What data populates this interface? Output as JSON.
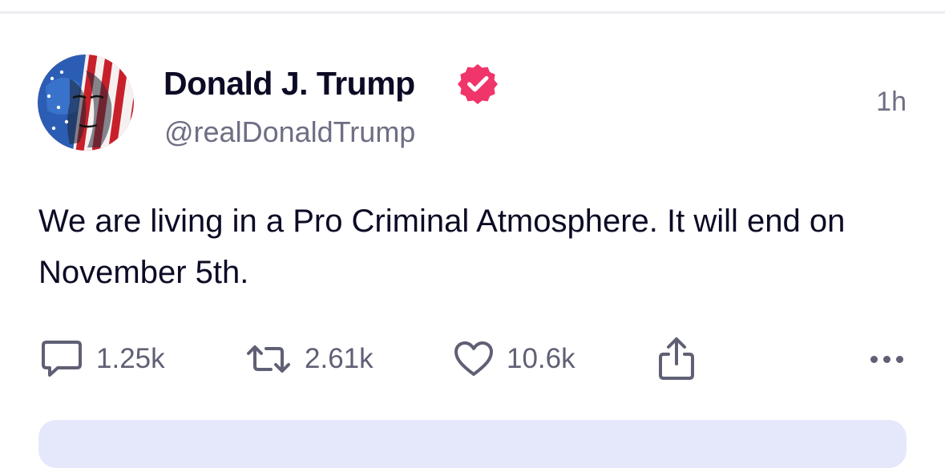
{
  "post": {
    "author": {
      "display_name": "Donald J. Trump",
      "handle": "@realDonaldTrump",
      "verified": true,
      "verified_color": "#f0356a"
    },
    "timestamp": "1h",
    "text": "We are living in a Pro Criminal Atmosphere. It will end on November 5th.",
    "actions": {
      "reply_count": "1.25k",
      "retruth_count": "2.61k",
      "like_count": "10.6k"
    },
    "icons": {
      "reply": "speech-bubble-icon",
      "retruth": "repost-arrows-icon",
      "like": "heart-icon",
      "share": "share-icon",
      "more": "ellipsis-icon"
    }
  }
}
